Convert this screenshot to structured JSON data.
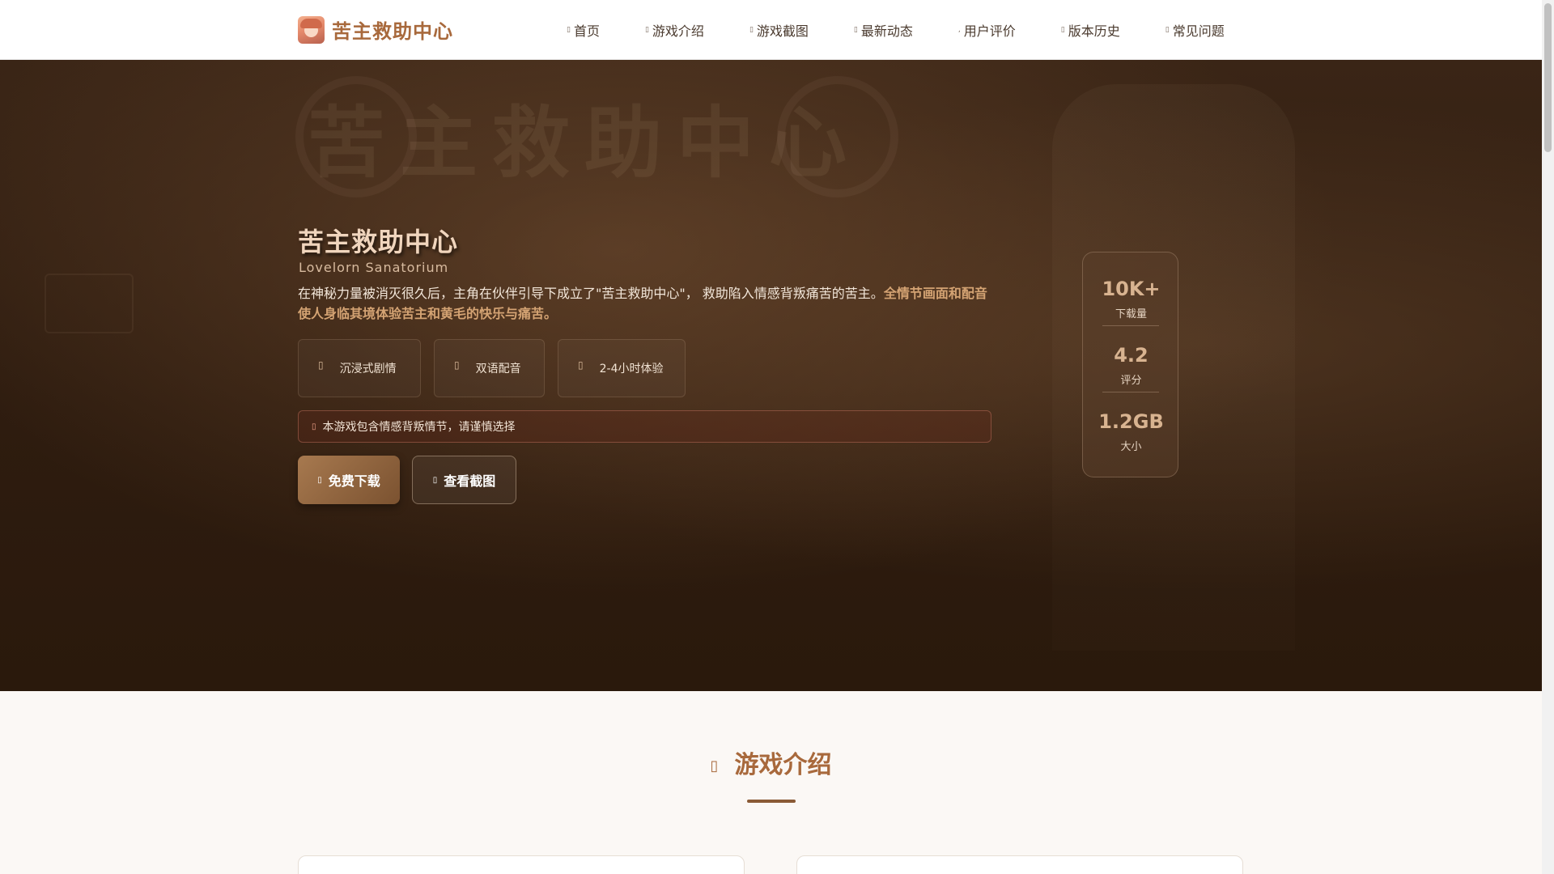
{
  "brand": {
    "name": "苦主救助中心"
  },
  "nav": {
    "items": [
      {
        "icon": "home-icon",
        "label": "首页"
      },
      {
        "icon": "gamepad-icon",
        "label": "游戏介绍"
      },
      {
        "icon": "image-icon",
        "label": "游戏截图"
      },
      {
        "icon": "news-icon",
        "label": "最新动态"
      },
      {
        "icon": "comment-icon",
        "label": "用户评价"
      },
      {
        "icon": "history-icon",
        "label": "版本历史"
      },
      {
        "icon": "question-icon",
        "label": "常见问题"
      }
    ]
  },
  "hero": {
    "title": "苦主救助中心",
    "subtitle": "Lovelorn Sanatorium",
    "description": "在神秘力量被消灭很久后，主角在伙伴引导下成立了\"苦主救助中心\"， 救助陷入情感背叛痛苦的苦主。",
    "description_highlight": "全情节画面和配音使人身临其境体验苦主和黄毛的快乐与痛苦。",
    "features": [
      {
        "icon": "book-icon",
        "label": "沉浸式剧情"
      },
      {
        "icon": "microphone-icon",
        "label": "双语配音"
      },
      {
        "icon": "clock-icon",
        "label": "2-4小时体验"
      }
    ],
    "warning": "本游戏包含情感背叛情节，请谨慎选择",
    "download_label": "免费下载",
    "screenshots_label": "查看截图"
  },
  "stats": [
    {
      "value": "10K+",
      "label": "下载量"
    },
    {
      "value": "4.2",
      "label": "评分"
    },
    {
      "value": "1.2GB",
      "label": "大小"
    }
  ],
  "section": {
    "title": "游戏介绍",
    "icon": "gamepad-icon"
  },
  "colors": {
    "accent": "#a8693c",
    "hero_bg": "#2e1c0f",
    "highlight": "#d4a373"
  }
}
